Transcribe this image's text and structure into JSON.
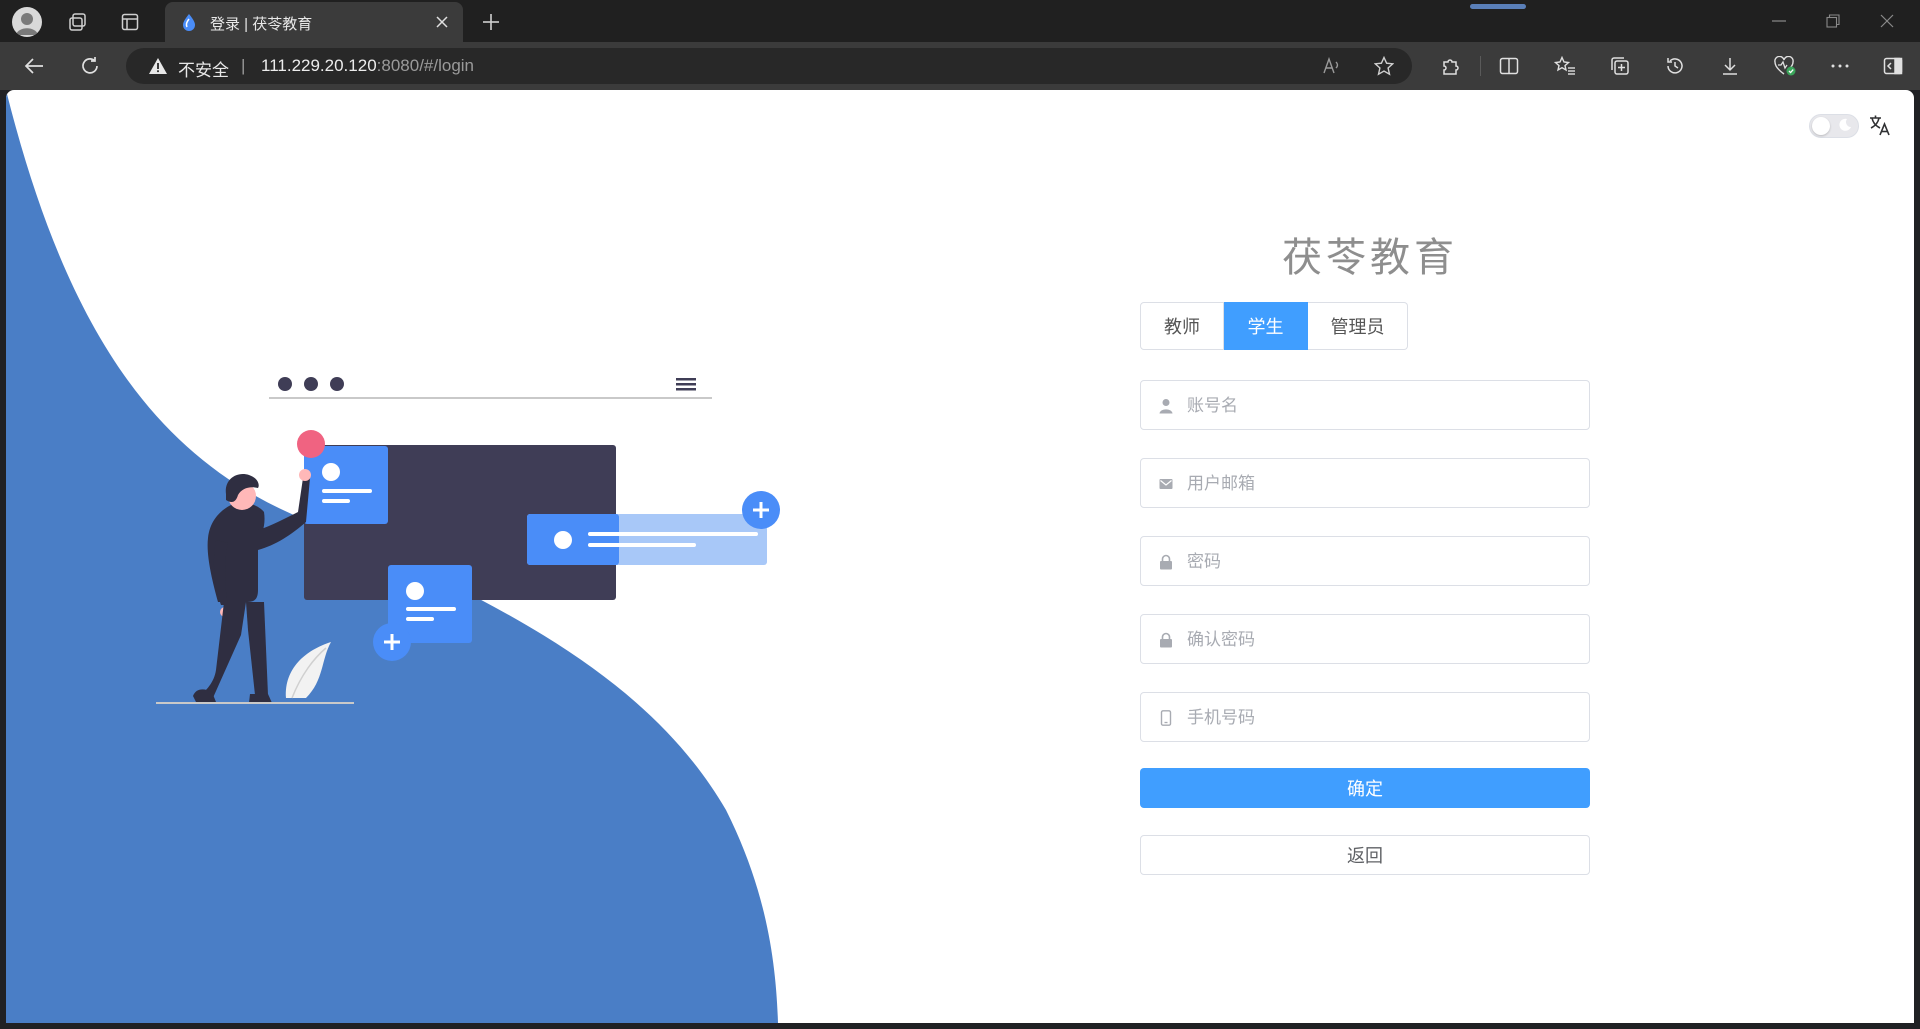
{
  "browser": {
    "tab_title": "登录 | 茯苓教育",
    "address": {
      "security_label": "不安全",
      "separator": "|",
      "host": "111.229.20.120",
      "rest": ":8080/#/login"
    }
  },
  "page": {
    "title": "茯苓教育",
    "roles": [
      "教师",
      "学生",
      "管理员"
    ],
    "active_role": "学生",
    "fields": {
      "account": {
        "placeholder": "账号名",
        "value": ""
      },
      "email": {
        "placeholder": "用户邮箱",
        "value": ""
      },
      "password": {
        "placeholder": "密码",
        "value": ""
      },
      "confirm_password": {
        "placeholder": "确认密码",
        "value": ""
      },
      "phone": {
        "placeholder": "手机号码",
        "value": ""
      }
    },
    "confirm_button": "确定",
    "back_button": "返回"
  },
  "colors": {
    "accent": "#409eff",
    "illustration_blue": "#4a7ec6",
    "dark_panel": "#3f3d56",
    "pink": "#f06381"
  },
  "icons": [
    "profile-icon",
    "workspaces-icon",
    "tab-actions-icon",
    "edge-drop-icon",
    "close-icon",
    "new-tab-icon",
    "back-icon",
    "refresh-icon",
    "warning-icon",
    "read-aloud-icon",
    "favorite-star-icon",
    "extensions-icon",
    "split-screen-icon",
    "favorites-icon",
    "collections-icon",
    "history-icon",
    "download-icon",
    "performance-icon",
    "more-icon",
    "sidebar-icon",
    "moon-icon",
    "translate-icon",
    "user-icon",
    "mail-icon",
    "lock-icon",
    "phone-icon"
  ]
}
